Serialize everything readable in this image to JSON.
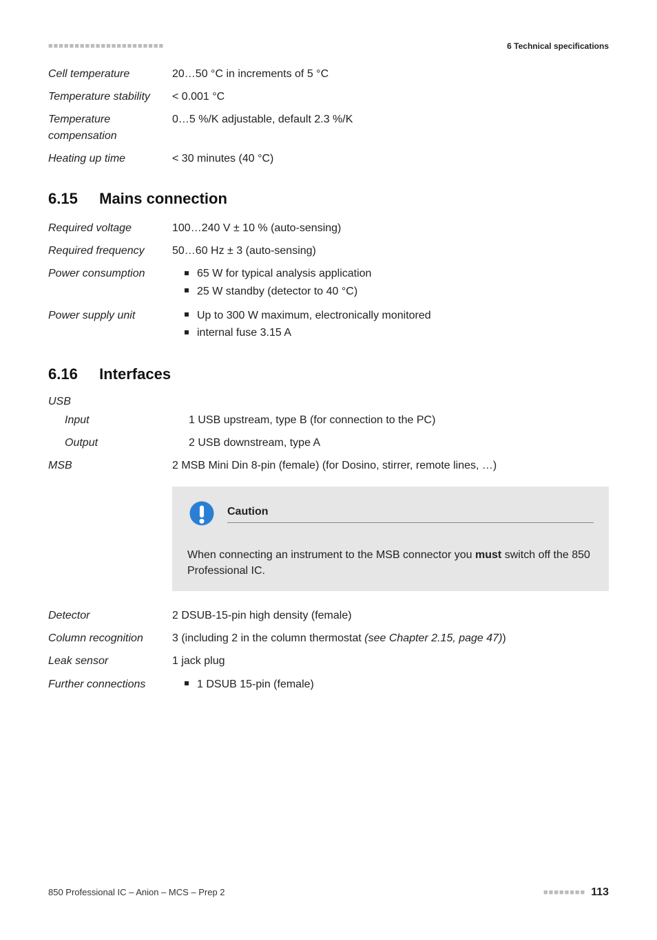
{
  "header": {
    "chapter": "6 Technical specifications"
  },
  "thermo": {
    "cell_temp": {
      "label": "Cell tempera­ture",
      "value": "20…50 °C in increments of 5 °C"
    },
    "stability": {
      "label": "Temperature stability",
      "value": "< 0.001 °C"
    },
    "compensation": {
      "label": "Temperature compensation",
      "value": "0…5 %/K adjustable, default 2.3 %/K"
    },
    "heatup": {
      "label": "Heating up time",
      "value": "< 30 minutes (40 °C)"
    }
  },
  "section_mains": {
    "num": "6.15",
    "title": "Mains connection"
  },
  "mains": {
    "voltage": {
      "label": "Required voltage",
      "value": "100…240 V ± 10 % (auto-sensing)"
    },
    "frequency": {
      "label": "Required fre­quency",
      "value": "50…60 Hz ± 3 (auto-sensing)"
    },
    "consumption": {
      "label": "Power consump­tion",
      "bullets": [
        "65 W for typical analysis application",
        "25 W standby (detector to 40 °C)"
      ]
    },
    "psu": {
      "label": "Power supply unit",
      "bullets": [
        "Up to 300 W maximum, electronically monitored",
        "internal fuse 3.15 A"
      ]
    }
  },
  "section_interfaces": {
    "num": "6.16",
    "title": "Interfaces"
  },
  "interfaces": {
    "usb": {
      "label": "USB",
      "input": {
        "label": "Input",
        "value": "1 USB upstream, type B (for connection to the PC)"
      },
      "output": {
        "label": "Output",
        "value": "2 USB downstream, type A"
      }
    },
    "msb": {
      "label": "MSB",
      "value": "2 MSB Mini Din 8-pin (female) (for Dosino, stirrer, remote lines, …)"
    },
    "caution": {
      "title": "Caution",
      "body_pre": "When connecting an instrument to the MSB connector you ",
      "body_bold": "must",
      "body_post": " switch off the 850 Professional IC."
    },
    "detector": {
      "label": "Detector",
      "value": "2 DSUB-15-pin high density (female)"
    },
    "column": {
      "label": "Column recogni­tion",
      "value_pre": "3 (including 2 in the column thermostat ",
      "value_ref": "(see Chapter 2.15, page 47)",
      "value_post": ")"
    },
    "leak": {
      "label": "Leak sensor",
      "value": "1 jack plug"
    },
    "further": {
      "label": "Further connec­tions",
      "bullets": [
        "1 DSUB 15-pin (female)"
      ]
    }
  },
  "footer": {
    "doc": "850 Professional IC – Anion – MCS – Prep 2",
    "page": "113"
  }
}
